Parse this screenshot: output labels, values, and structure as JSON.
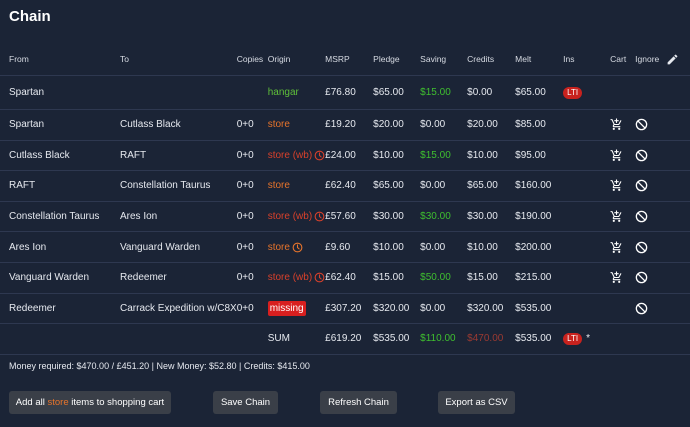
{
  "title": "Chain",
  "columns": {
    "from": "From",
    "to": "To",
    "copies": "Copies",
    "origin": "Origin",
    "msrp": "MSRP",
    "pledge": "Pledge",
    "saving": "Saving",
    "credits": "Credits",
    "melt": "Melt",
    "ins": "Ins",
    "cart": "Cart",
    "ignore": "Ignore"
  },
  "rows": [
    {
      "from": "Spartan",
      "to": "",
      "copies": "",
      "origin": "hangar",
      "msrp": "£76.80",
      "pledge": "$65.00",
      "saving": "$15.00",
      "credits": "$0.00",
      "melt": "$65.00",
      "ins": "LTI"
    },
    {
      "from": "Spartan",
      "to": "Cutlass Black",
      "copies": "0+0",
      "origin": "store",
      "msrp": "£19.20",
      "pledge": "$20.00",
      "saving": "$0.00",
      "credits": "$20.00",
      "melt": "$85.00",
      "ins": ""
    },
    {
      "from": "Cutlass Black",
      "to": "RAFT",
      "copies": "0+0",
      "origin": "store (wb)",
      "msrp": "£24.00",
      "pledge": "$10.00",
      "saving": "$15.00",
      "credits": "$10.00",
      "melt": "$95.00",
      "ins": ""
    },
    {
      "from": "RAFT",
      "to": "Constellation Taurus",
      "copies": "0+0",
      "origin": "store",
      "msrp": "£62.40",
      "pledge": "$65.00",
      "saving": "$0.00",
      "credits": "$65.00",
      "melt": "$160.00",
      "ins": ""
    },
    {
      "from": "Constellation Taurus",
      "to": "Ares Ion",
      "copies": "0+0",
      "origin": "store (wb)",
      "msrp": "£57.60",
      "pledge": "$30.00",
      "saving": "$30.00",
      "credits": "$30.00",
      "melt": "$190.00",
      "ins": ""
    },
    {
      "from": "Ares Ion",
      "to": "Vanguard Warden",
      "copies": "0+0",
      "origin": "store",
      "msrp": "£9.60",
      "pledge": "$10.00",
      "saving": "$0.00",
      "credits": "$10.00",
      "melt": "$200.00",
      "ins": ""
    },
    {
      "from": "Vanguard Warden",
      "to": "Redeemer",
      "copies": "0+0",
      "origin": "store (wb)",
      "msrp": "£62.40",
      "pledge": "$15.00",
      "saving": "$50.00",
      "credits": "$15.00",
      "melt": "$215.00",
      "ins": ""
    },
    {
      "from": "Redeemer",
      "to": "Carrack Expedition w/C8X",
      "copies": "0+0",
      "origin": "missing",
      "msrp": "£307.20",
      "pledge": "$320.00",
      "saving": "$0.00",
      "credits": "$320.00",
      "melt": "$535.00",
      "ins": ""
    }
  ],
  "sum": {
    "label": "SUM",
    "msrp": "£619.20",
    "pledge": "$535.00",
    "saving": "$110.00",
    "credits": "$470.00",
    "melt": "$535.00",
    "ins": "LTI",
    "star": "*"
  },
  "money_line": "Money required: $470.00 / £451.20 | New Money: $52.80 | Credits: $415.00",
  "buttons": {
    "add_prefix": "Add all",
    "add_store": "store",
    "add_suffix": "items to shopping cart",
    "save": "Save Chain",
    "refresh": "Refresh Chain",
    "export": "Export as CSV"
  }
}
